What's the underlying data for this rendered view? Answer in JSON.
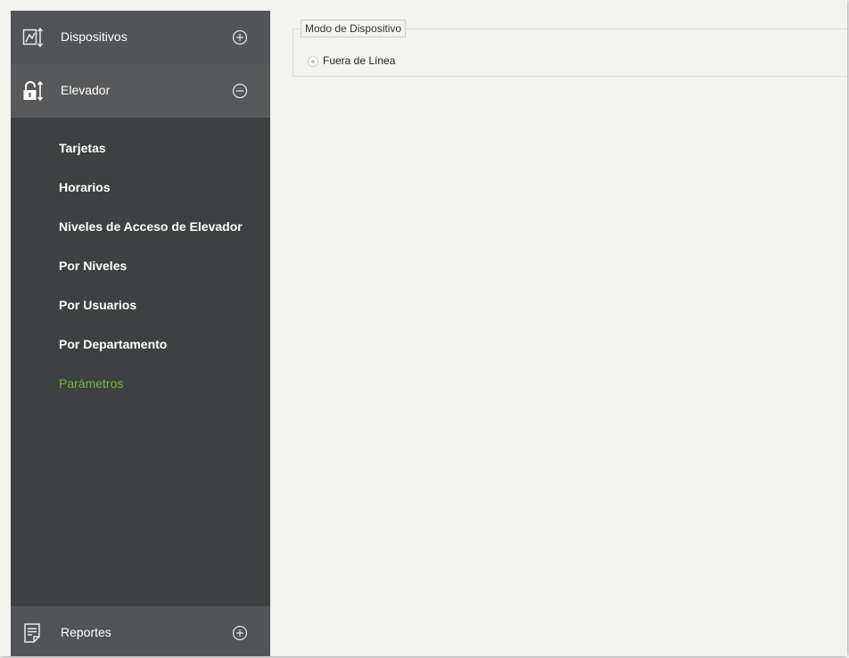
{
  "sidebar": {
    "sections": {
      "devices": {
        "label": "Dispositivos",
        "icon": "devices-icon",
        "toggle": "plus"
      },
      "elevator": {
        "label": "Elevador",
        "icon": "elevator-lock-icon",
        "toggle": "minus"
      },
      "reports": {
        "label": "Reportes",
        "icon": "reports-icon",
        "toggle": "plus"
      }
    },
    "items": [
      {
        "label": "Tarjetas",
        "active": false
      },
      {
        "label": "Horarios",
        "active": false
      },
      {
        "label": "Niveles de Acceso de Elevador",
        "active": false
      },
      {
        "label": "Por Niveles",
        "active": false
      },
      {
        "label": "Por Usuarios",
        "active": false
      },
      {
        "label": "Por Departamento",
        "active": false
      },
      {
        "label": "Parámetros",
        "active": true
      }
    ]
  },
  "main": {
    "device_mode": {
      "legend": "Modo de Dispositivo",
      "option": {
        "label": "Fuera de Línea",
        "selected": true,
        "disabled": true
      }
    }
  },
  "colors": {
    "sidebar_bg": "#3e4142",
    "sidebar_header_bg": "#525558",
    "active_item": "#74b42a",
    "content_bg": "#f3f3f0"
  }
}
